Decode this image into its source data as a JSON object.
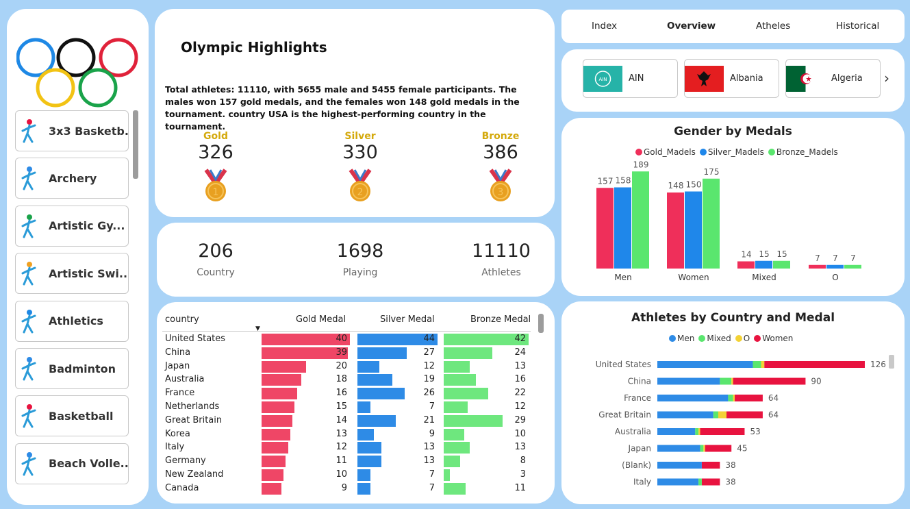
{
  "sidebar": {
    "sports": [
      {
        "label": "3x3 Basketb...",
        "icon": "basketball-3x3-icon"
      },
      {
        "label": "Archery",
        "icon": "archery-icon"
      },
      {
        "label": "Artistic Gy...",
        "icon": "artistic-gymnastics-icon"
      },
      {
        "label": "Artistic Swi...",
        "icon": "artistic-swimming-icon"
      },
      {
        "label": "Athletics",
        "icon": "athletics-icon"
      },
      {
        "label": "Badminton",
        "icon": "badminton-icon"
      },
      {
        "label": "Basketball",
        "icon": "basketball-icon"
      },
      {
        "label": "Beach Volle...",
        "icon": "beach-volleyball-icon"
      }
    ]
  },
  "highlights": {
    "title": "Olympic Highlights",
    "summary": "Total athletes: 11110, with 5655 male and 5455 female participants. The males won 157 gold medals, and the females won 148 gold medals in the tournament. country USA is the highest-performing country in the tournament.",
    "medals": [
      {
        "name": "Gold",
        "count": "326",
        "rank": "1",
        "color": "#e8a020"
      },
      {
        "name": "Silver",
        "count": "330",
        "rank": "2",
        "color": "#e8a020"
      },
      {
        "name": "Bronze",
        "count": "386",
        "rank": "3",
        "color": "#e8a020"
      }
    ]
  },
  "kpis": [
    {
      "value": "206",
      "label": "Country"
    },
    {
      "value": "1698",
      "label": "Playing"
    },
    {
      "value": "11110",
      "label": "Athletes"
    }
  ],
  "medal_table": {
    "headers": {
      "country": "country",
      "gold": "Gold Medal",
      "silver": "Silver Medal",
      "bronze": "Bronze Medal"
    },
    "colors": {
      "gold": "#ef4666",
      "silver": "#2e8be6",
      "bronze": "#6ee77e"
    },
    "rows": [
      {
        "country": "United States",
        "gold": 40,
        "silver": 44,
        "bronze": 42
      },
      {
        "country": "China",
        "gold": 39,
        "silver": 27,
        "bronze": 24
      },
      {
        "country": "Japan",
        "gold": 20,
        "silver": 12,
        "bronze": 13
      },
      {
        "country": "Australia",
        "gold": 18,
        "silver": 19,
        "bronze": 16
      },
      {
        "country": "France",
        "gold": 16,
        "silver": 26,
        "bronze": 22
      },
      {
        "country": "Netherlands",
        "gold": 15,
        "silver": 7,
        "bronze": 12
      },
      {
        "country": "Great Britain",
        "gold": 14,
        "silver": 21,
        "bronze": 29
      },
      {
        "country": "Korea",
        "gold": 13,
        "silver": 9,
        "bronze": 10
      },
      {
        "country": "Italy",
        "gold": 12,
        "silver": 13,
        "bronze": 13
      },
      {
        "country": "Germany",
        "gold": 11,
        "silver": 13,
        "bronze": 8
      },
      {
        "country": "New Zealand",
        "gold": 10,
        "silver": 7,
        "bronze": 3
      },
      {
        "country": "Canada",
        "gold": 9,
        "silver": 7,
        "bronze": 11
      }
    ]
  },
  "nav": {
    "tabs": [
      {
        "label": "Index",
        "active": false
      },
      {
        "label": "Overview",
        "active": true
      },
      {
        "label": "Atheles",
        "active": false
      },
      {
        "label": "Historical",
        "active": false
      }
    ]
  },
  "countries": [
    {
      "name": "AIN",
      "flag": "ain-flag-icon",
      "badge": "AIN"
    },
    {
      "name": "Albania",
      "flag": "albania-flag-icon"
    },
    {
      "name": "Algeria",
      "flag": "algeria-flag-icon"
    }
  ],
  "chart_data": [
    {
      "type": "bar",
      "title": "Gender by Medals",
      "categories": [
        "Men",
        "Women",
        "Mixed",
        "O"
      ],
      "series": [
        {
          "name": "Gold_Madels",
          "color": "#ef2f5a",
          "values": [
            157,
            148,
            14,
            7
          ]
        },
        {
          "name": "Silver_Madels",
          "color": "#1f87ea",
          "values": [
            158,
            150,
            15,
            7
          ]
        },
        {
          "name": "Bronze_Madels",
          "color": "#5ae66e",
          "values": [
            189,
            175,
            15,
            7
          ]
        }
      ],
      "ylim": [
        0,
        200
      ],
      "legend": "top",
      "grid": false
    },
    {
      "type": "bar",
      "orientation": "horizontal",
      "stacked": true,
      "title": "Athletes by Country and Medal",
      "categories": [
        "United States",
        "China",
        "France",
        "Great Britain",
        "Australia",
        "Japan",
        "(Blank)",
        "Italy"
      ],
      "series": [
        {
          "name": "Men",
          "color": "#2e8be6",
          "values": [
            58,
            38,
            43,
            34,
            23,
            26,
            27,
            25
          ]
        },
        {
          "name": "Mixed",
          "color": "#5ae66e",
          "values": [
            5,
            7,
            3,
            3,
            2,
            2,
            0,
            2
          ]
        },
        {
          "name": "O",
          "color": "#f3d235",
          "values": [
            2,
            1,
            1,
            5,
            1,
            1,
            0,
            0
          ]
        },
        {
          "name": "Women",
          "color": "#e8133f",
          "values": [
            61,
            44,
            17,
            22,
            27,
            16,
            11,
            11
          ]
        }
      ],
      "totals": [
        126,
        90,
        64,
        64,
        53,
        45,
        38,
        38
      ],
      "xlim": [
        0,
        126
      ],
      "legend": "top",
      "grid": false
    }
  ]
}
